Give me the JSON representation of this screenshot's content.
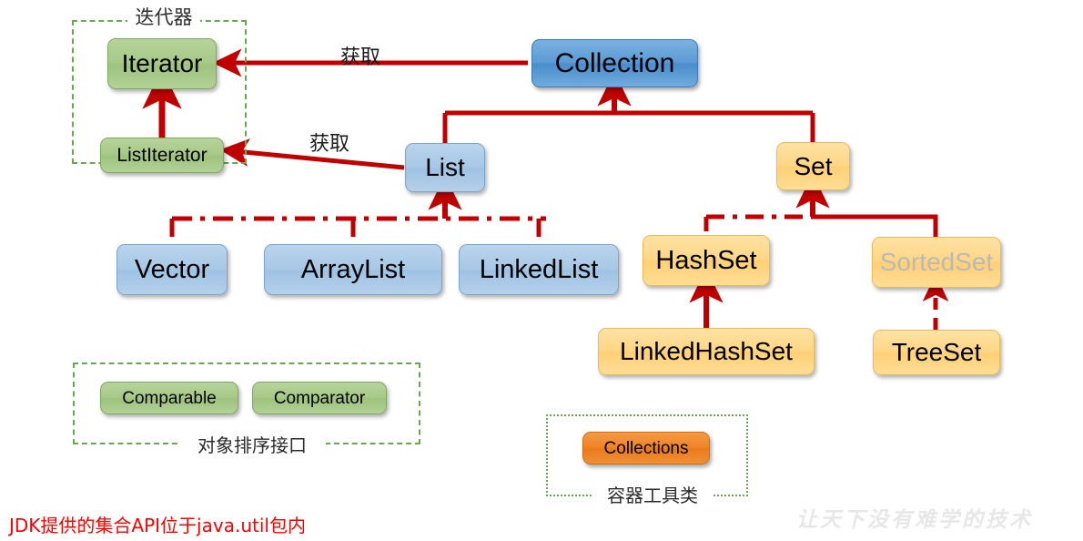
{
  "diagram": {
    "title_visible": false,
    "accent_line_color": "#c00000",
    "caption": "JDK提供的集合API位于java.util包内",
    "watermark": "让天下没有难学的技术"
  },
  "frames": [
    {
      "id": "iterator-group",
      "label": "迭代器"
    },
    {
      "id": "sorting-group",
      "label": "对象排序接口"
    },
    {
      "id": "utility-group",
      "label": "容器工具类"
    }
  ],
  "edge_labels": [
    {
      "id": "collection-to-iterator",
      "text": "获取"
    },
    {
      "id": "list-to-listiterator",
      "text": "获取"
    }
  ],
  "nodes": {
    "iterator": {
      "label": "Iterator",
      "style": "green",
      "color": "#a6c988"
    },
    "list_iterator": {
      "label": "ListIterator",
      "style": "green",
      "color": "#a6c988"
    },
    "collection": {
      "label": "Collection",
      "style": "blue-dark",
      "color": "#5c9ad4"
    },
    "list": {
      "label": "List",
      "style": "blue-light",
      "color": "#a8c8e6"
    },
    "set": {
      "label": "Set",
      "style": "yellow",
      "color": "#ffd685"
    },
    "vector": {
      "label": "Vector",
      "style": "blue-light",
      "color": "#a8c8e6"
    },
    "array_list": {
      "label": "ArrayList",
      "style": "blue-light",
      "color": "#a8c8e6"
    },
    "linked_list": {
      "label": "LinkedList",
      "style": "blue-light",
      "color": "#a8c8e6"
    },
    "hash_set": {
      "label": "HashSet",
      "style": "yellow",
      "color": "#ffd685"
    },
    "sorted_set": {
      "label": "SortedSet",
      "style": "yellow",
      "color": "#ffd685",
      "text_color": "#b9b9b9"
    },
    "linked_hash_set": {
      "label": "LinkedHashSet",
      "style": "yellow",
      "color": "#ffd685"
    },
    "tree_set": {
      "label": "TreeSet",
      "style": "yellow",
      "color": "#ffd685"
    },
    "comparable": {
      "label": "Comparable",
      "style": "green",
      "color": "#a6c988"
    },
    "comparator": {
      "label": "Comparator",
      "style": "green",
      "color": "#a6c988"
    },
    "collections": {
      "label": "Collections",
      "style": "orange",
      "color": "#ef8326"
    }
  }
}
